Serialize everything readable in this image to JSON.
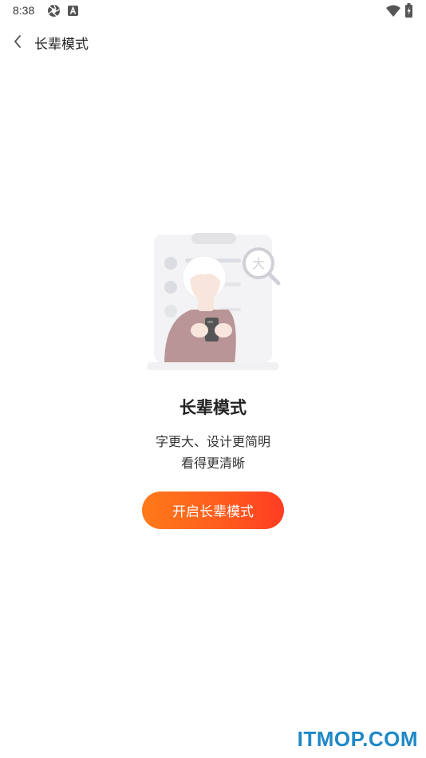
{
  "status_bar": {
    "time": "8:38",
    "icons": [
      "aperture-icon",
      "a-notification-icon",
      "wifi-icon",
      "battery-charging-icon"
    ]
  },
  "nav": {
    "back_icon": "chevron-left-icon",
    "title": "长辈模式"
  },
  "illustration": {
    "icon": "elderly-person-phone-magnifier-illustration",
    "magnifier_char": "大"
  },
  "content": {
    "title": "长辈模式",
    "desc_line1": "字更大、设计更简明",
    "desc_line2": "看得更清晰"
  },
  "button": {
    "label": "开启长辈模式"
  },
  "watermark": "ITMOP.COM",
  "colors": {
    "button_gradient_start": "#ff7a1a",
    "button_gradient_end": "#ff3c22",
    "watermark": "#1e88c8"
  }
}
